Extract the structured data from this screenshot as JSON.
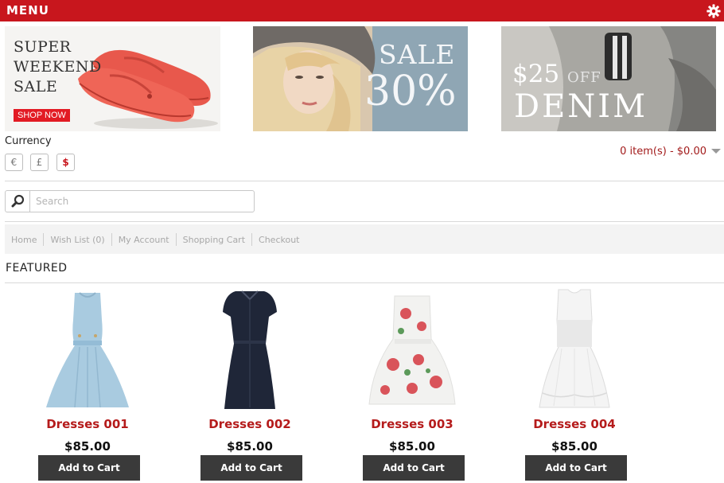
{
  "header": {
    "menu_label": "MENU",
    "settings_icon": "gear-icon"
  },
  "banners": [
    {
      "lines": [
        "SUPER",
        "WEEKEND",
        "SALE"
      ],
      "button": "SHOP NOW"
    },
    {
      "line1": "SALE",
      "line2": "30%"
    },
    {
      "price": "$25",
      "off": "OFF",
      "line2": "DENIM"
    }
  ],
  "currency": {
    "title": "Currency",
    "options": [
      "€",
      "£",
      "$"
    ],
    "selected": "$"
  },
  "cart": {
    "summary": "0 item(s) - $0.00"
  },
  "search": {
    "placeholder": "Search",
    "value": "",
    "icon": "search-icon"
  },
  "nav": {
    "links": [
      "Home",
      "Wish List (0)",
      "My Account",
      "Shopping Cart",
      "Checkout"
    ]
  },
  "featured": {
    "title": "FEATURED",
    "products": [
      {
        "name": "Dresses 001",
        "price": "$85.00",
        "button": "Add to Cart",
        "color": "#a9cbe0"
      },
      {
        "name": "Dresses 002",
        "price": "$85.00",
        "button": "Add to Cart",
        "color": "#1f2638"
      },
      {
        "name": "Dresses 003",
        "price": "$85.00",
        "button": "Add to Cart",
        "color": "#f2f2f0"
      },
      {
        "name": "Dresses 004",
        "price": "$85.00",
        "button": "Add to Cart",
        "color": "#f4f4f4"
      }
    ]
  },
  "colors": {
    "brand": "#c8161d",
    "product_name": "#b51b1b",
    "button": "#3a3a3a"
  }
}
